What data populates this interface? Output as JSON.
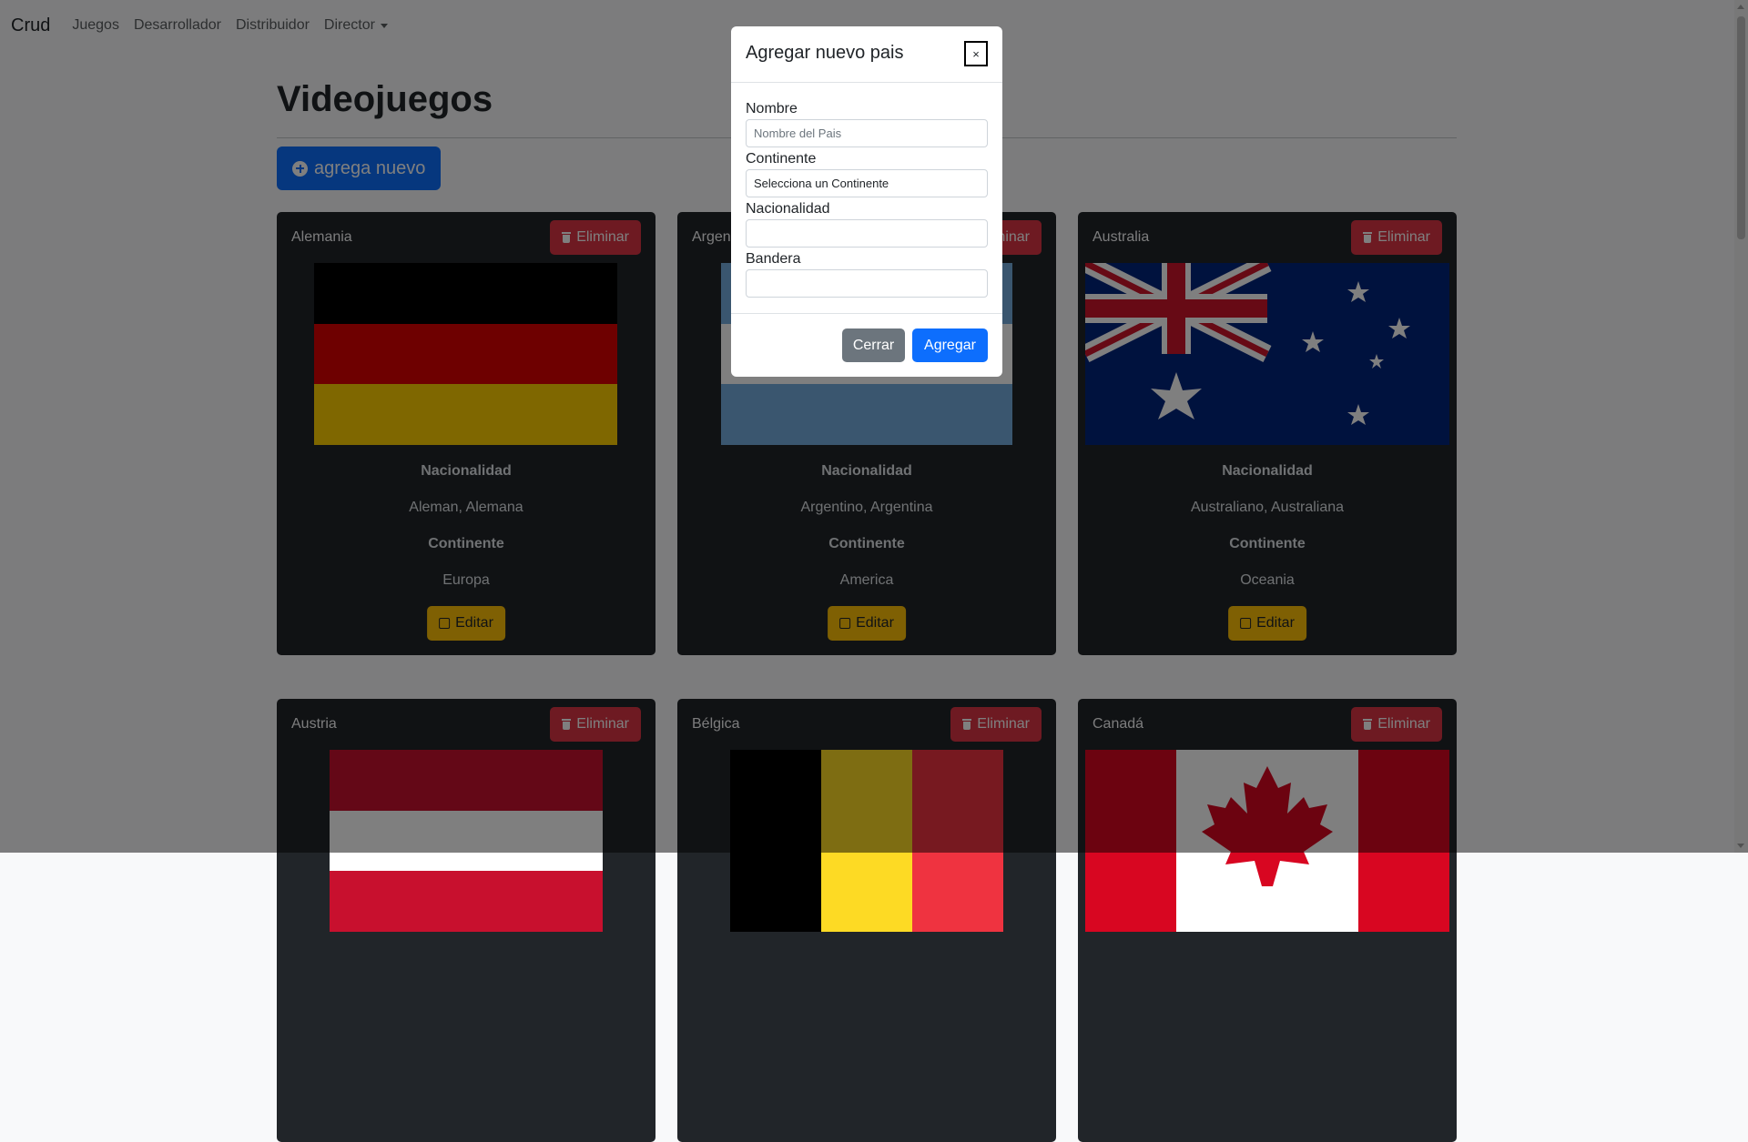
{
  "navbar": {
    "brand": "Crud",
    "links": [
      "Juegos",
      "Desarrollador",
      "Distribuidor",
      "Director"
    ]
  },
  "page": {
    "title": "Videojuegos",
    "add_button": "agrega nuevo"
  },
  "cards": [
    {
      "name": "Alemania",
      "delete_label": "Eliminar",
      "nationality_label": "Nacionalidad",
      "nationality": "Aleman, Alemana",
      "continent_label": "Continente",
      "continent": "Europa",
      "edit_label": "Editar"
    },
    {
      "name": "Argentina",
      "delete_label": "Eliminar",
      "nationality_label": "Nacionalidad",
      "nationality": "Argentino, Argentina",
      "continent_label": "Continente",
      "continent": "America",
      "edit_label": "Editar"
    },
    {
      "name": "Australia",
      "delete_label": "Eliminar",
      "nationality_label": "Nacionalidad",
      "nationality": "Australiano, Australiana",
      "continent_label": "Continente",
      "continent": "Oceania",
      "edit_label": "Editar"
    },
    {
      "name": "Austria",
      "delete_label": "Eliminar"
    },
    {
      "name": "Bélgica",
      "delete_label": "Eliminar"
    },
    {
      "name": "Canadá",
      "delete_label": "Eliminar"
    }
  ],
  "modal": {
    "title": "Agregar nuevo pais",
    "close_x": "×",
    "fields": {
      "nombre_label": "Nombre",
      "nombre_placeholder": "Nombre del Pais",
      "continente_label": "Continente",
      "continente_value": "Selecciona un Continente",
      "nacionalidad_label": "Nacionalidad",
      "bandera_label": "Bandera"
    },
    "close_button": "Cerrar",
    "add_button": "Agregar"
  },
  "colors": {
    "primary": "#0d6efd",
    "danger": "#dc3545",
    "warning": "#ffc107",
    "secondary": "#6c757d",
    "card_bg": "#212529"
  }
}
